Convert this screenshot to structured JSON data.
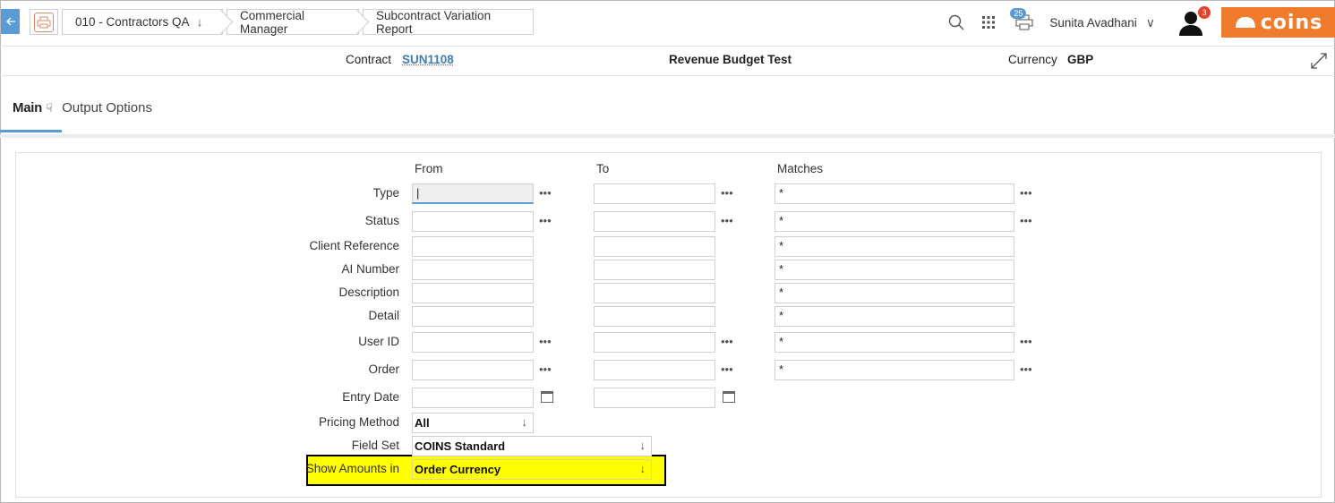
{
  "breadcrumbs": [
    {
      "label": "010 - Contractors QA"
    },
    {
      "label": "Commercial Manager"
    },
    {
      "label": "Subcontract Variation Report"
    }
  ],
  "header": {
    "user_name": "Sunita Avadhani",
    "notifications_count": "25",
    "alerts_count": "3",
    "logo_text": "COINS"
  },
  "contract_bar": {
    "contract_label": "Contract",
    "contract_value": "SUN1108",
    "title": "Revenue Budget Test",
    "currency_label": "Currency",
    "currency_value": "GBP"
  },
  "tabs": [
    {
      "label": "Main",
      "active": true
    },
    {
      "label": "Output Options",
      "active": false
    }
  ],
  "form": {
    "col_from": "From",
    "col_to": "To",
    "col_matches": "Matches",
    "rows": [
      {
        "label": "Type",
        "from": "|",
        "to": "",
        "matches": "*"
      },
      {
        "label": "Status",
        "from": "",
        "to": "",
        "matches": "*"
      },
      {
        "label": "Client Reference",
        "from": "",
        "to": "",
        "matches": "*"
      },
      {
        "label": "AI Number",
        "from": "",
        "to": "",
        "matches": "*"
      },
      {
        "label": "Description",
        "from": "",
        "to": "",
        "matches": "*"
      },
      {
        "label": "Detail",
        "from": "",
        "to": "",
        "matches": "*"
      },
      {
        "label": "User ID",
        "from": "",
        "to": "",
        "matches": "*"
      },
      {
        "label": "Order",
        "from": "",
        "to": "",
        "matches": "*"
      },
      {
        "label": "Entry Date",
        "from": "",
        "to": ""
      }
    ],
    "pricing_method": {
      "label": "Pricing Method",
      "value": "All"
    },
    "field_set": {
      "label": "Field Set",
      "value": "COINS Standard"
    },
    "show_amounts": {
      "label": "Show Amounts in",
      "value": "Order Currency"
    }
  },
  "colors": {
    "accent": "#5b9bd5",
    "brand": "#f07b2c",
    "highlight": "#ffff00"
  }
}
